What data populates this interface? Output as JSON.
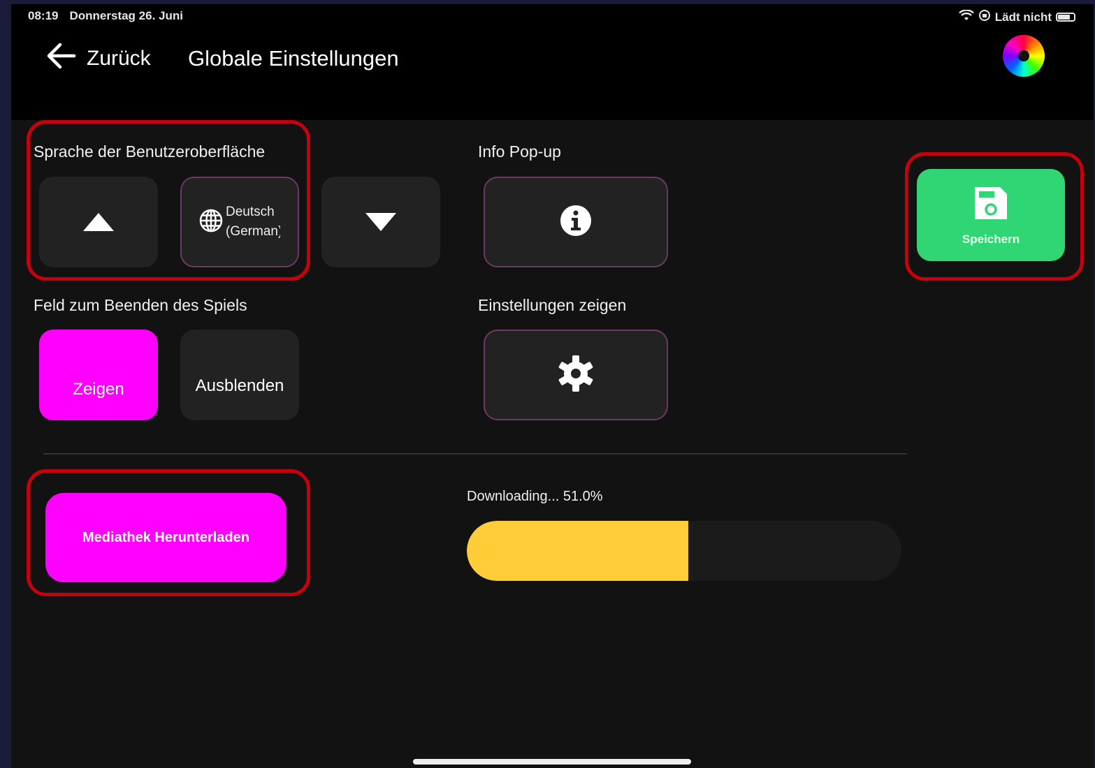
{
  "status_bar": {
    "time": "08:19",
    "date": "Donnerstag 26. Juni",
    "charging": "Lädt nicht",
    "icons": [
      "wifi-icon",
      "orientation-lock-icon",
      "battery-icon"
    ]
  },
  "header": {
    "back_label": "Zurück",
    "title": "Globale Einstellungen",
    "theme_icon": "color-wheel-icon"
  },
  "language": {
    "label": "Sprache der Benutzeroberfläche",
    "current_line1": "Deutsch",
    "current_line2": "(German)",
    "icons": [
      "arrow-up-icon",
      "globe-icon",
      "arrow-down-icon"
    ]
  },
  "info_popup": {
    "label": "Info Pop-up",
    "icon": "info-icon"
  },
  "save": {
    "label": "Speichern",
    "icon": "save-icon",
    "color": "#2fd673"
  },
  "end_game_field": {
    "label": "Feld zum Beenden des Spiels",
    "show_label": "Zeigen",
    "hide_label": "Ausblenden",
    "selected": "Zeigen",
    "active_color": "#ff00ff"
  },
  "settings_visibility": {
    "label": "Einstellungen zeigen",
    "icon": "gear-icon"
  },
  "media": {
    "download_label": "Mediathek Herunterladen"
  },
  "download": {
    "status_text": "Downloading... 51.0%",
    "progress_percent": 51.0,
    "bar_color": "#ffcd38"
  },
  "annotation_color": "#c8000d"
}
